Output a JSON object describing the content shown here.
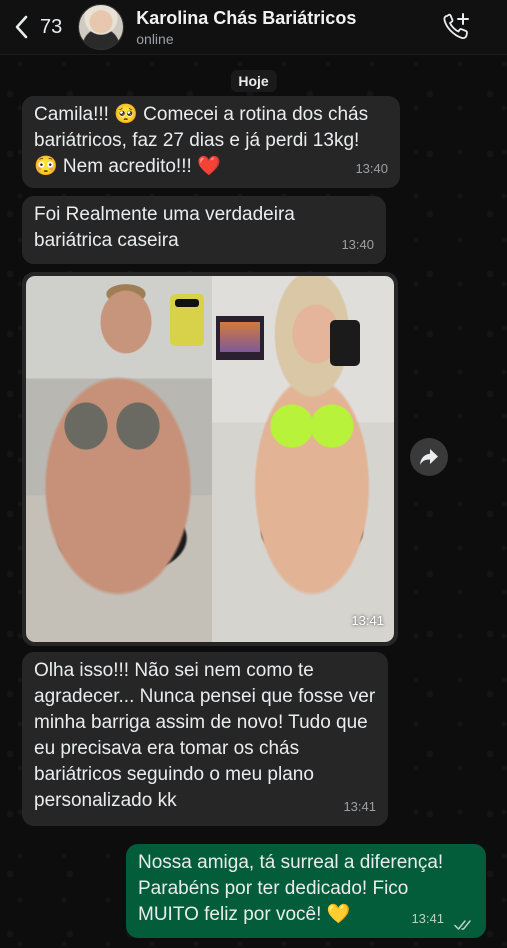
{
  "header": {
    "back_count": "73",
    "contact_name": "Karolina Chás Bariátricos",
    "status": "online"
  },
  "date_chip": "Hoje",
  "messages": [
    {
      "direction": "incoming",
      "text": "Camila!!! 🥺 Comecei a rotina dos chás bariátricos, faz 27 dias e já perdi 13kg! 😳 Nem acredito!!! ❤️",
      "time": "13:40"
    },
    {
      "direction": "incoming",
      "text": "Foi Realmente uma verdadeira bariátrica caseira",
      "time": "13:40"
    },
    {
      "direction": "incoming",
      "type": "image",
      "time": "13:41"
    },
    {
      "direction": "incoming",
      "text": "Olha isso!!! Não sei nem como te agradecer... Nunca pensei que fosse ver minha barriga assim de novo! Tudo que eu precisava era tomar os chás bariátricos seguindo o meu plano personalizado kk",
      "time": "13:41"
    },
    {
      "direction": "outgoing",
      "text": "Nossa amiga, tá surreal a diferença! Parabéns por ter dedicado! Fico MUITO feliz por você! 💛",
      "time": "13:41",
      "status": "read"
    }
  ],
  "icons": {
    "back": "chevron-left-icon",
    "call": "add-call-icon",
    "forward": "forward-icon",
    "read_receipt": "double-check-icon"
  },
  "colors": {
    "incoming_bubble": "#262626",
    "outgoing_bubble": "#035c3a",
    "background": "#0d0d0d"
  }
}
